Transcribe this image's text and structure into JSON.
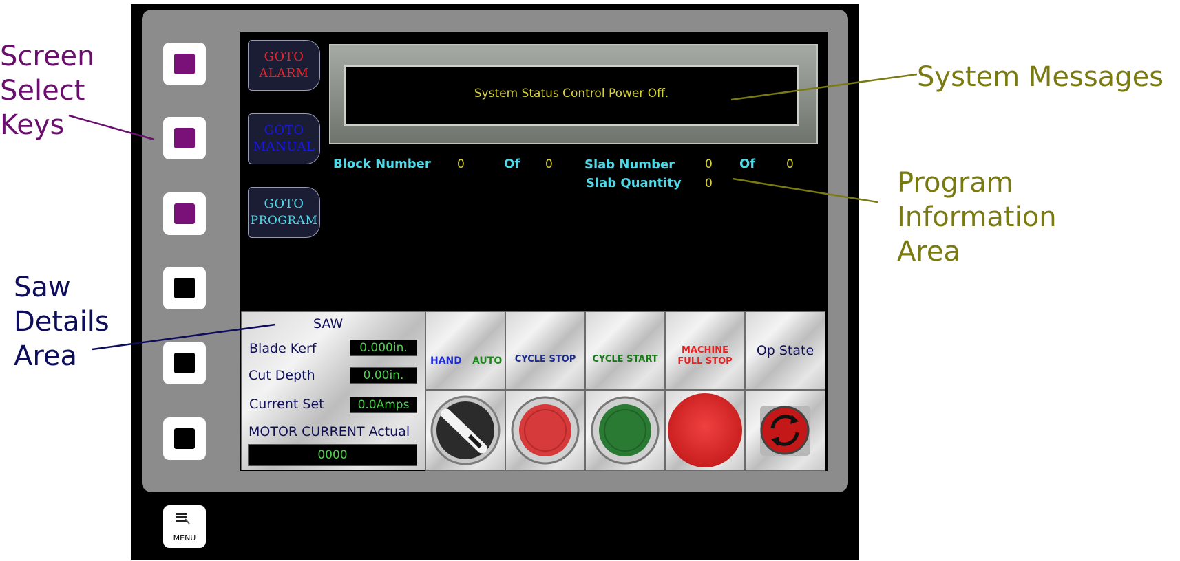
{
  "annotations": {
    "screen_select": [
      "Screen",
      "Select",
      "Keys"
    ],
    "saw_details": [
      "Saw",
      "Details",
      "Area"
    ],
    "system_messages": "System Messages",
    "program_info": [
      "Program Information",
      "Area"
    ]
  },
  "colors": {
    "screen_select": "#6a0f6e",
    "saw_details": "#0d0d5c",
    "system_messages": "#7a7a12",
    "program_info": "#7a7a12"
  },
  "goto_buttons": [
    {
      "line1": "GOTO",
      "line2": "ALARM",
      "color": "#e8262a"
    },
    {
      "line1": "GOTO",
      "line2": "MANUAL",
      "color": "#1818e0"
    },
    {
      "line1": "GOTO",
      "line2": "PROGRAM",
      "color": "#4ed8e8"
    }
  ],
  "system_message": "System Status Control Power Off.",
  "program_info": {
    "block_label": "Block Number",
    "block_value": "0",
    "block_of_label": "Of",
    "block_total": "0",
    "slab_label": "Slab Number",
    "slab_value": "0",
    "slab_of_label": "Of",
    "slab_total": "0",
    "slab_qty_label": "Slab Quantity",
    "slab_qty_value": "0"
  },
  "saw": {
    "title": "SAW",
    "blade_kerf_label": "Blade Kerf",
    "blade_kerf_value": "0.000in.",
    "cut_depth_label": "Cut Depth",
    "cut_depth_value": "0.00in.",
    "current_set_label": "Current Set",
    "current_set_value": "0.0Amps",
    "motor_current_label": "MOTOR CURRENT Actual",
    "motor_current_value": "0000"
  },
  "controls": {
    "hand": "HAND",
    "auto": "AUTO",
    "cycle_stop": "CYCLE STOP",
    "cycle_start": "CYCLE START",
    "machine_full_stop_1": "MACHINE",
    "machine_full_stop_2": "FULL STOP",
    "op_state": "Op State"
  },
  "menu_label": "MENU",
  "screen_keys": [
    "purple",
    "purple",
    "purple",
    "black",
    "black",
    "black"
  ]
}
